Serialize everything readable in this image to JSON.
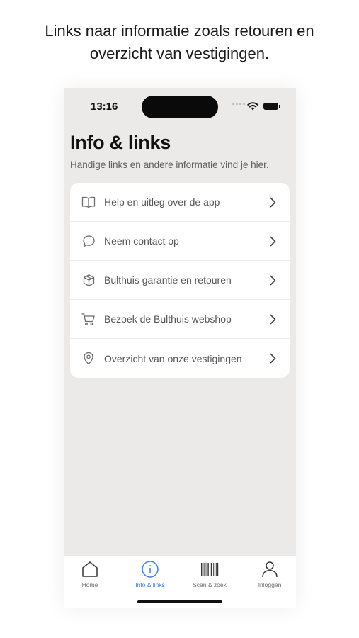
{
  "caption": {
    "line1": "Links naar informatie zoals retouren en",
    "line2": "overzicht van vestigingen."
  },
  "status_bar": {
    "time": "13:16"
  },
  "page": {
    "title": "Info & links",
    "subtitle": "Handige links en andere informatie vind je hier."
  },
  "links": [
    {
      "label": "Help en uitleg over de app",
      "icon": "book-icon"
    },
    {
      "label": "Neem contact op",
      "icon": "chat-bubble-icon"
    },
    {
      "label": "Bulthuis garantie en retouren",
      "icon": "package-icon"
    },
    {
      "label": "Bezoek de Bulthuis webshop",
      "icon": "cart-icon"
    },
    {
      "label": "Overzicht van onze vestigingen",
      "icon": "location-pin-icon"
    }
  ],
  "tab_bar": {
    "tabs": [
      {
        "label": "Home",
        "icon": "home-icon"
      },
      {
        "label": "Info & links",
        "icon": "info-icon",
        "active": true
      },
      {
        "label": "Scan & zoek",
        "icon": "barcode-icon"
      },
      {
        "label": "Inloggen",
        "icon": "user-icon"
      }
    ]
  },
  "colors": {
    "accent": "#3d7fe6",
    "background": "#ebeae9",
    "card": "#ffffff"
  }
}
